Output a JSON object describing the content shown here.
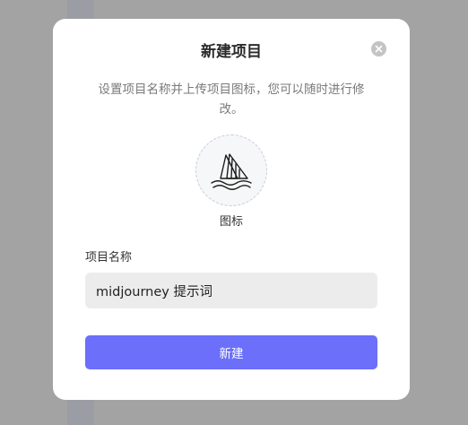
{
  "dialog": {
    "title": "新建项目",
    "subtitle": "设置项目名称并上传项目图标，您可以随时进行修改。",
    "icon_label": "图标",
    "name_label": "项目名称",
    "name_value": "midjourney 提示词",
    "create_label": "新建"
  },
  "icons": {
    "close": "close-icon",
    "project_icon": "sailboat-icon"
  },
  "colors": {
    "primary_button": "#6b6ff9",
    "overlay": "#a3a3a3"
  }
}
